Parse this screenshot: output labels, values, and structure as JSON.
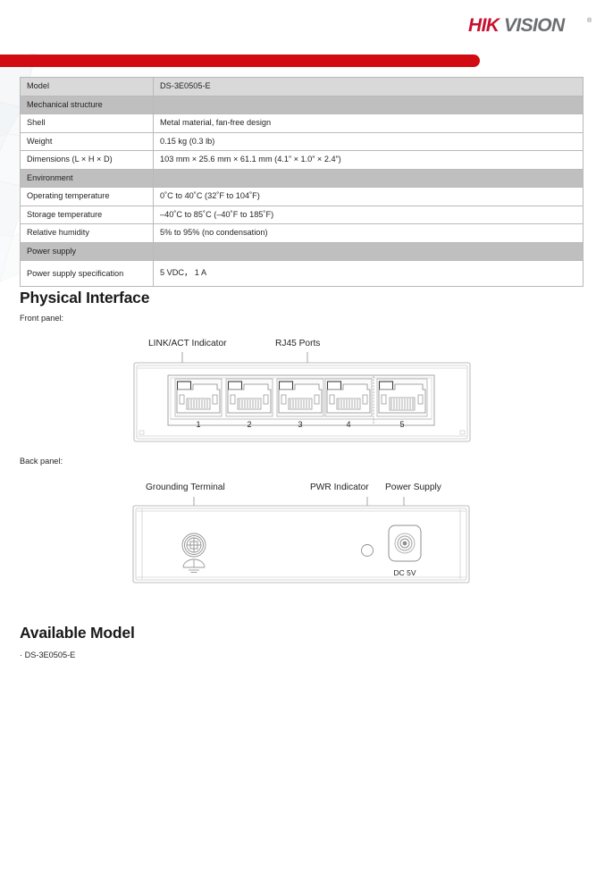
{
  "brand": {
    "logo_text": "HIKVISION",
    "logo_color": "#c8102e",
    "accent_bar_color": "#d20a12"
  },
  "spec_table": {
    "rows": [
      {
        "type": "model",
        "label": "Model",
        "value": "DS-3E0505-E"
      },
      {
        "type": "section",
        "label": "Mechanical structure",
        "value": ""
      },
      {
        "type": "data",
        "label": "Shell",
        "value": "Metal material, fan-free design"
      },
      {
        "type": "data",
        "label": "Weight",
        "value": "0.15 kg (0.3 lb)"
      },
      {
        "type": "data",
        "label": "Dimensions (L × H × D)",
        "value": "103 mm × 25.6 mm × 61.1 mm (4.1” × 1.0” × 2.4”)"
      },
      {
        "type": "section",
        "label": "Environment",
        "value": ""
      },
      {
        "type": "data",
        "label": "Operating temperature",
        "value": "0˚C to 40˚C (32˚F to 104˚F)"
      },
      {
        "type": "data",
        "label": "Storage temperature",
        "value": "–40˚C to 85˚C (–40˚F to 185˚F)"
      },
      {
        "type": "data",
        "label": "Relative humidity",
        "value": "5% to 95% (no condensation)"
      },
      {
        "type": "section",
        "label": "Power supply",
        "value": ""
      },
      {
        "type": "tall",
        "label": "Power supply specification",
        "value": "5 VDC， 1 A"
      }
    ]
  },
  "physical_interface": {
    "heading": "Physical Interface",
    "front_caption": "Front panel:",
    "back_caption": "Back panel:",
    "front_callouts": [
      {
        "name": "link-act-indicator",
        "label": "LINK/ACT Indicator"
      },
      {
        "name": "rj45-ports",
        "label": "RJ45 Ports"
      }
    ],
    "front_port_numbers": [
      "1",
      "2",
      "3",
      "4",
      "5"
    ],
    "back_callouts": [
      {
        "name": "grounding-terminal",
        "label": "Grounding Terminal"
      },
      {
        "name": "pwr-indicator",
        "label": "PWR Indicator"
      },
      {
        "name": "power-supply",
        "label": "Power Supply"
      }
    ],
    "back_port_label": "DC 5V"
  },
  "available_model": {
    "heading": "Available Model",
    "items": [
      "DS-3E0505-E"
    ],
    "bullet_glyph": "·"
  }
}
